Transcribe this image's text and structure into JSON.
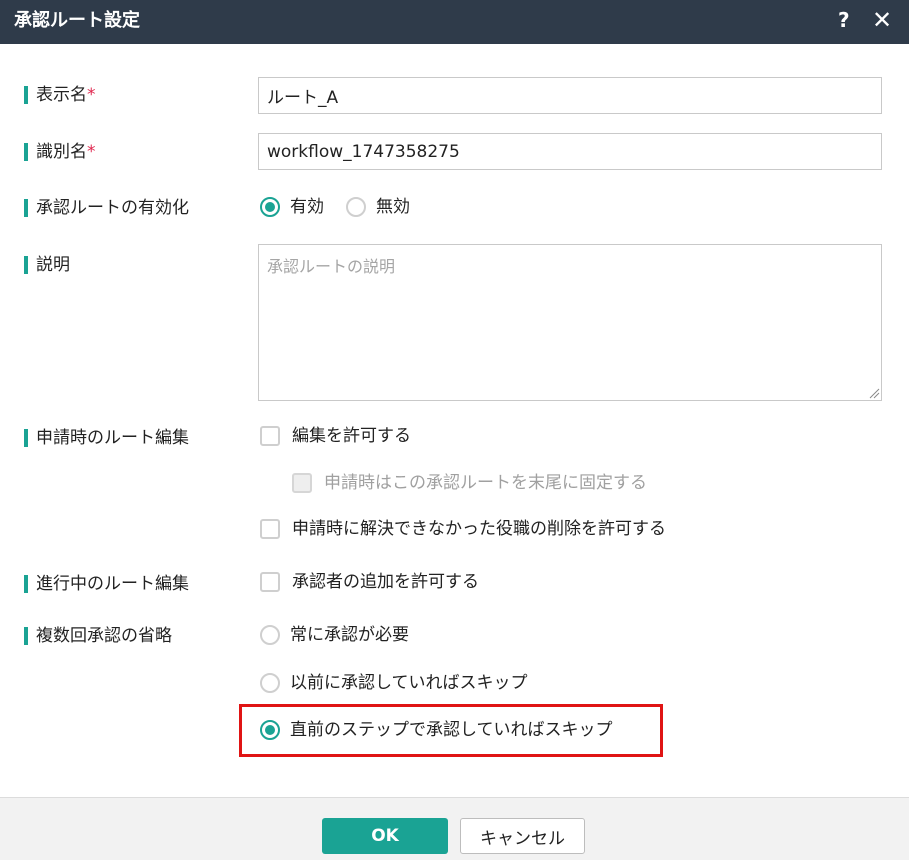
{
  "dialog": {
    "title": "承認ルート設定",
    "help_icon": "?",
    "close_icon": "✕"
  },
  "form": {
    "display_name": {
      "label": "表示名",
      "required_mark": "*",
      "value": "ルート_A"
    },
    "identifier": {
      "label": "識別名",
      "required_mark": "*",
      "value": "workflow_1747358275"
    },
    "enable": {
      "label": "承認ルートの有効化",
      "options": [
        {
          "label": "有効",
          "selected": true
        },
        {
          "label": "無効",
          "selected": false
        }
      ]
    },
    "description": {
      "label": "説明",
      "placeholder": "承認ルートの説明",
      "value": ""
    },
    "route_edit_on_apply": {
      "label": "申請時のルート編集",
      "options": [
        {
          "label": "編集を許可する",
          "checked": false,
          "disabled": false
        },
        {
          "label": "申請時はこの承認ルートを末尾に固定する",
          "checked": false,
          "disabled": true
        },
        {
          "label": "申請時に解決できなかった役職の削除を許可する",
          "checked": false,
          "disabled": false
        }
      ]
    },
    "route_edit_in_progress": {
      "label": "進行中のルート編集",
      "options": [
        {
          "label": "承認者の追加を許可する",
          "checked": false,
          "disabled": false
        }
      ]
    },
    "skip_repeat": {
      "label": "複数回承認の省略",
      "options": [
        {
          "label": "常に承認が必要",
          "selected": false
        },
        {
          "label": "以前に承認していればスキップ",
          "selected": false
        },
        {
          "label": "直前のステップで承認していればスキップ",
          "selected": true
        }
      ]
    }
  },
  "footer": {
    "ok_label": "OK",
    "cancel_label": "キャンセル"
  },
  "colors": {
    "titlebar": "#2f3b4a",
    "accent": "#1aa394",
    "required": "#e0284f",
    "highlight": "#e01414"
  }
}
